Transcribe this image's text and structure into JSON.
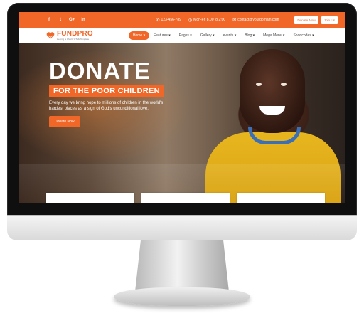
{
  "topbar": {
    "social": [
      "f",
      "t",
      "G+",
      "in"
    ],
    "phone": "123-456-789",
    "hours": "Mon-Fri 8.00 to 2:00",
    "email": "contact@yourdomain.com",
    "donate_label": "Donate Now",
    "join_label": "Join Us"
  },
  "nav": {
    "brand": "FUNDPRO",
    "tagline": "Helping & Charity HTML Template",
    "items": [
      "Home",
      "Features",
      "Pages",
      "Gallery",
      "events",
      "Blog",
      "Mega Menu",
      "Shortcodes"
    ]
  },
  "hero": {
    "title": "DONATE",
    "subtitle": "FOR THE POOR CHILDREN",
    "description": "Every day we bring hope to millions of children in the world's hardest places as a sign of God's unconditional love.",
    "cta": "Donate Now"
  },
  "colors": {
    "accent": "#f16727"
  }
}
